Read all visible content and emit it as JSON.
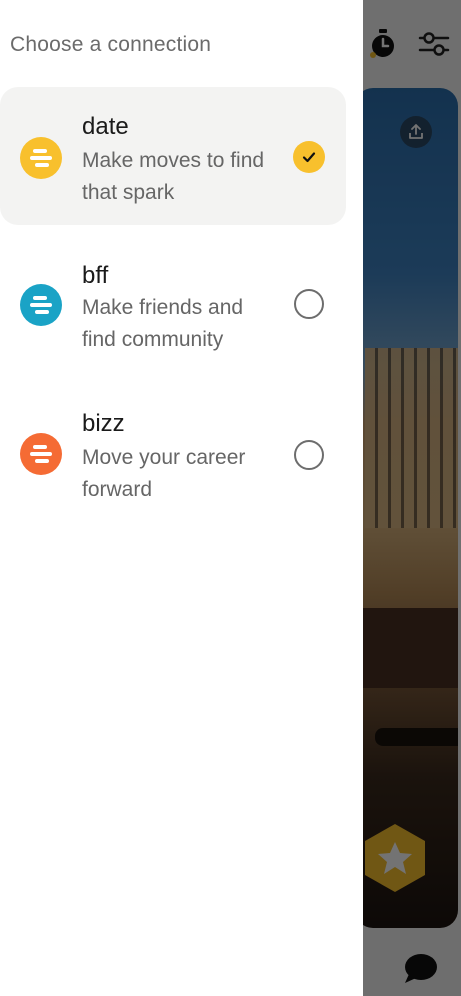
{
  "drawer": {
    "title": "Choose a connection",
    "options": [
      {
        "name": "date",
        "description": "Make moves to find that spark",
        "selected": true,
        "color": "#f8c02d"
      },
      {
        "name": "bff",
        "description": "Make friends and find community",
        "selected": false,
        "color": "#1aa3c6"
      },
      {
        "name": "bizz",
        "description": "Move your career forward",
        "selected": false,
        "color": "#f56b34"
      }
    ],
    "check_color": "#f8c02d"
  },
  "background": {
    "icons": [
      "timer-icon",
      "filter-icon",
      "share-icon",
      "superswipe-star-icon",
      "chat-icon"
    ]
  }
}
